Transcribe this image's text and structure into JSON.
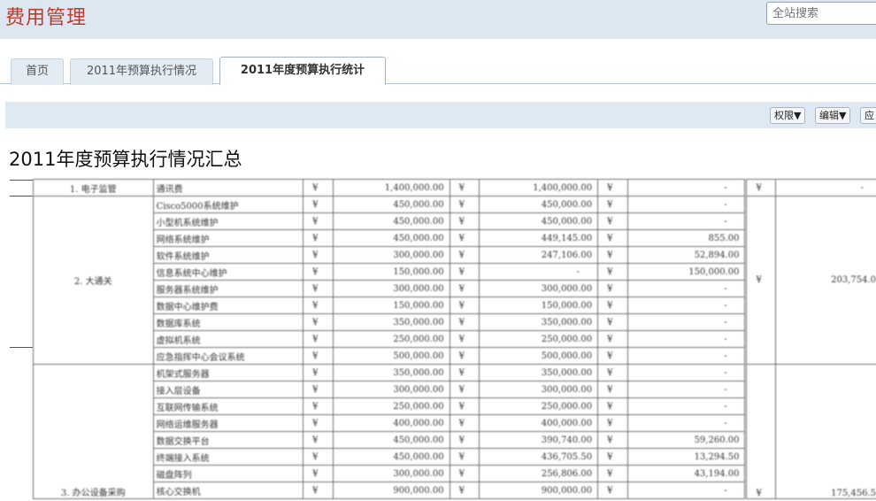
{
  "header": {
    "app_title": "费用管理",
    "search_placeholder": "全站搜索"
  },
  "tabs": [
    {
      "label": "首页",
      "active": false
    },
    {
      "label": "2011年预算执行情况",
      "active": false
    },
    {
      "label": "2011年度预算执行统计",
      "active": true
    }
  ],
  "toolbar": {
    "permissions_label": "权限▼",
    "edit_label": "编辑▼",
    "apply_label": "应"
  },
  "page": {
    "heading": "2011年度预算执行情况汇总"
  },
  "table": {
    "currency_symbol": "¥",
    "rows": [
      {
        "cat": "1. 电子监管",
        "item": "通讯费",
        "budget": "1,400,000.00",
        "spent": "1,400,000.00",
        "remain": "-",
        "group_total": "-"
      },
      {
        "cat": "",
        "item": "Cisco5000系统维护",
        "budget": "450,000.00",
        "spent": "450,000.00",
        "remain": "-"
      },
      {
        "cat": "",
        "item": "小型机系统维护",
        "budget": "450,000.00",
        "spent": "450,000.00",
        "remain": "-"
      },
      {
        "cat": "",
        "item": "网络系统维护",
        "budget": "450,000.00",
        "spent": "449,145.00",
        "remain": "855.00"
      },
      {
        "cat": "",
        "item": "软件系统维护",
        "budget": "300,000.00",
        "spent": "247,106.00",
        "remain": "52,894.00"
      },
      {
        "cat": "",
        "item": "信息系统中心维护",
        "budget": "150,000.00",
        "spent": "-",
        "remain": "150,000.00"
      },
      {
        "cat": "",
        "item": "服务器系统维护",
        "budget": "300,000.00",
        "spent": "300,000.00",
        "remain": "-"
      },
      {
        "cat": "",
        "item": "数据中心维护费",
        "budget": "150,000.00",
        "spent": "150,000.00",
        "remain": "-"
      },
      {
        "cat": "",
        "item": "数据库系统",
        "budget": "350,000.00",
        "spent": "350,000.00",
        "remain": "-"
      },
      {
        "cat": "",
        "item": "虚拟机系统",
        "budget": "250,000.00",
        "spent": "250,000.00",
        "remain": "-"
      },
      {
        "cat": "",
        "item": "应急指挥中心会议系统",
        "budget": "500,000.00",
        "spent": "500,000.00",
        "remain": "-"
      },
      {
        "cat": "",
        "item": "机架式服务器",
        "budget": "350,000.00",
        "spent": "350,000.00",
        "remain": "-"
      },
      {
        "cat": "",
        "item": "接入层设备",
        "budget": "300,000.00",
        "spent": "300,000.00",
        "remain": "-"
      },
      {
        "cat": "",
        "item": "互联网传输系统",
        "budget": "250,000.00",
        "spent": "250,000.00",
        "remain": "-"
      },
      {
        "cat": "",
        "item": "网络运维服务器",
        "budget": "400,000.00",
        "spent": "400,000.00",
        "remain": "-"
      },
      {
        "cat": "",
        "item": "数据交换平台",
        "budget": "450,000.00",
        "spent": "390,740.00",
        "remain": "59,260.00"
      },
      {
        "cat": "",
        "item": "终端接入系统",
        "budget": "450,000.00",
        "spent": "436,705.50",
        "remain": "13,294.50"
      },
      {
        "cat": "",
        "item": "磁盘阵列",
        "budget": "300,000.00",
        "spent": "256,806.00",
        "remain": "43,194.00"
      },
      {
        "cat": "",
        "item": "核心交换机",
        "budget": "900,000.00",
        "spent": "900,000.00",
        "remain": "-"
      }
    ],
    "group_1_label": "2. 大通关",
    "group_1_total": "203,754.0",
    "group_2_label": "3. 办公设备采购",
    "group_2_total": "175,456.5"
  }
}
